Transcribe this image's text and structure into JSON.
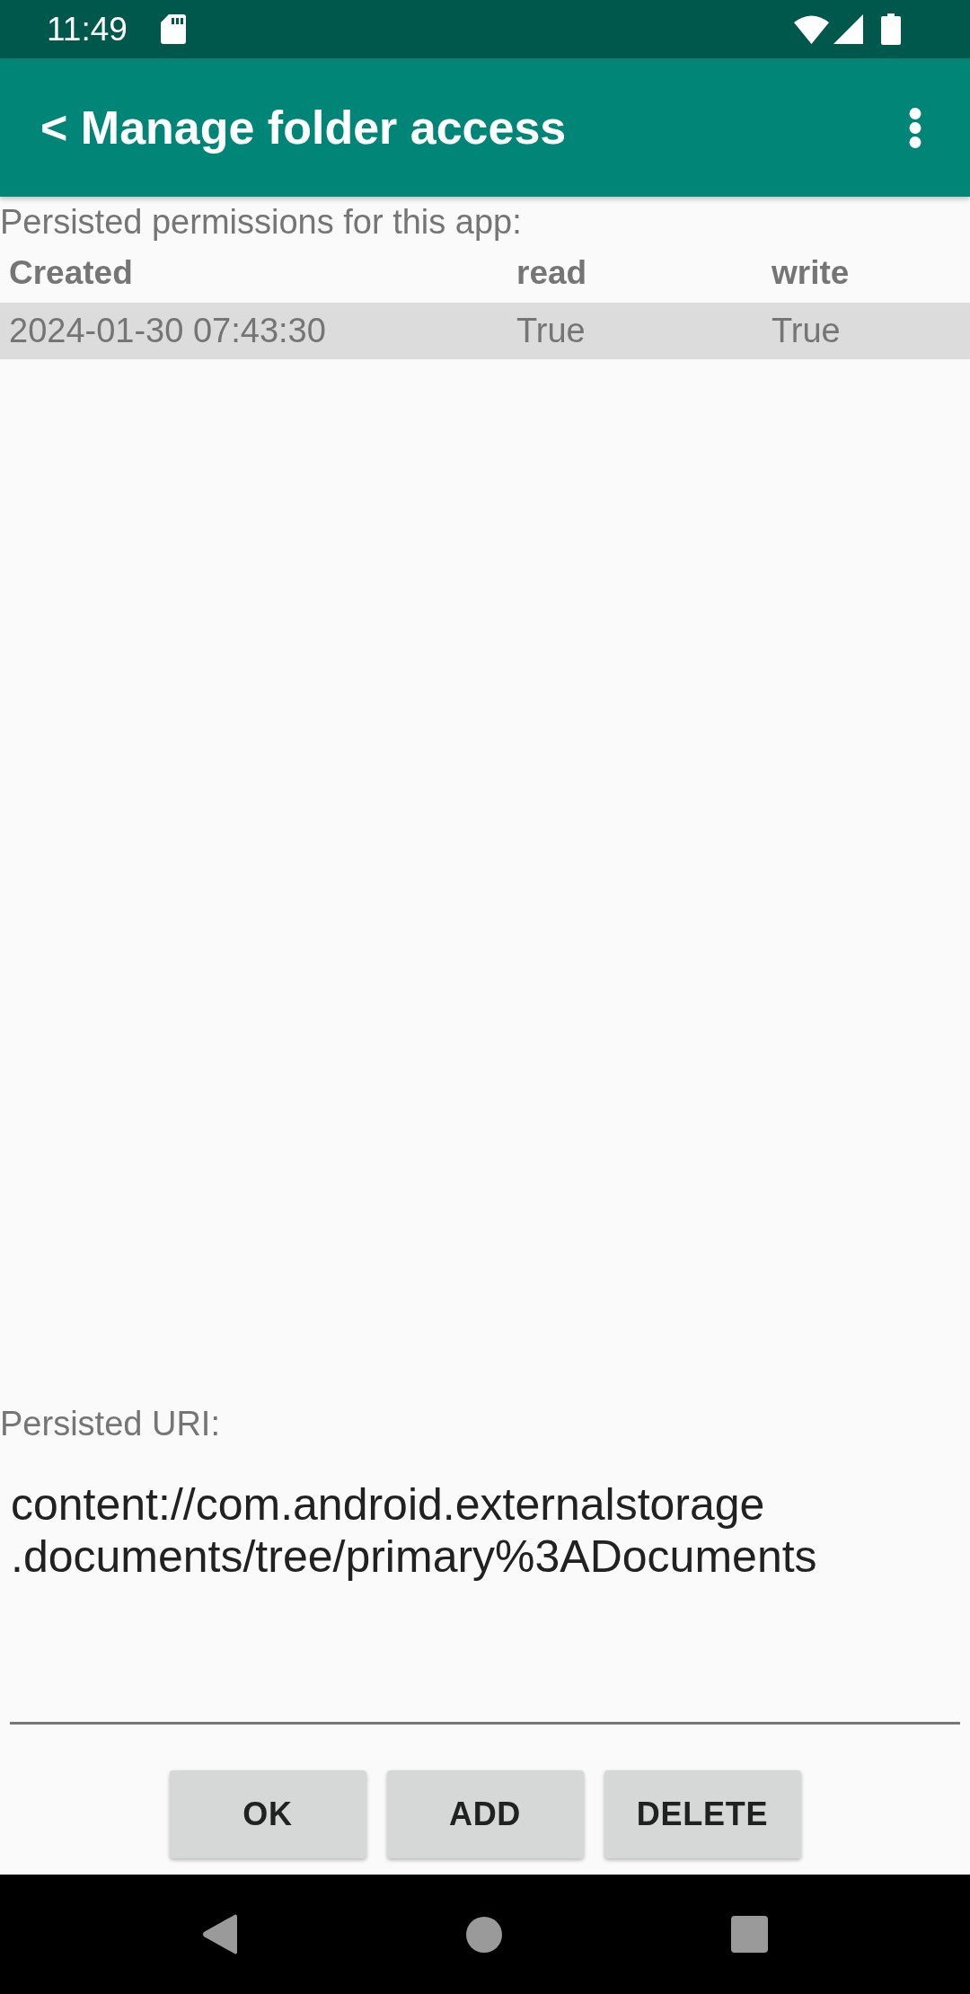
{
  "status_bar": {
    "time": "11:49"
  },
  "app_bar": {
    "title": "< Manage folder access"
  },
  "permissions": {
    "label": "Persisted permissions for this app:",
    "columns": [
      "Created",
      "read",
      "write"
    ],
    "rows": [
      {
        "cells": [
          "2024-01-30 07:43:30",
          "True",
          "True"
        ],
        "selected": true
      }
    ]
  },
  "uri": {
    "label": "Persisted URI:",
    "value": "content://com.android.externalstorage.documents/tree/primary%3ADocuments"
  },
  "buttons": [
    "OK",
    "ADD",
    "DELETE"
  ]
}
